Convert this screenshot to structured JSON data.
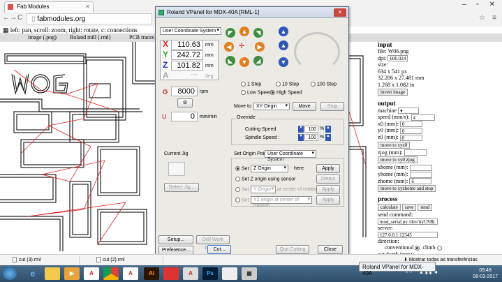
{
  "browser": {
    "tab_title": "Fab Modules",
    "url": "fabmodules.org",
    "nav_back": "←",
    "nav_forward": "→",
    "reload": "C",
    "window_controls": "– ▫ ✕",
    "star": "☆",
    "menu": "≡"
  },
  "fab": {
    "hint": "left: pan, scroll: zoom, right: rotate, c: connections",
    "fmt_image": "image (.png)",
    "fmt_machine": "Roland mill (.rml)",
    "fmt_process": "PCB traces (",
    "input": {
      "heading": "input",
      "file": "file: W06.png",
      "dpi_label": "dpi:",
      "dpi_value": "600.024",
      "size_label": "size:",
      "size_px": "634 x 541 px",
      "size_mm": "32.206 x 27.481 mm",
      "size_in": "1.268 x 1.082 in",
      "invert_button": "invert image"
    },
    "output": {
      "heading": "output",
      "machine_label": "machine",
      "speed_label": "speed (mm/s):",
      "speed_value": "4",
      "x0_label": "x0 (mm):",
      "x0_value": "0",
      "y0_label": "y0 (mm):",
      "y0_value": "0",
      "z0_label": "z0 (mm):",
      "z0_value": "0",
      "move_xyz0": "move to xyz0",
      "zjog_label": "zjog (mm):",
      "zjog_value": "",
      "move_xy0zjog": "move to xy0 zjog",
      "xhome_label": "xhome (mm):",
      "yhome_label": "yhome (mm):",
      "zhome_label": "zhome (mm):",
      "zhome_value": "6",
      "move_home": "move to xyzhome and stop"
    },
    "process": {
      "heading": "process",
      "calculate": "calculate",
      "save": "save",
      "send": "send",
      "send_command_label": "send command:",
      "send_command_value": "mod_serial.py /dev/ttyUSB(",
      "server_label": "server:",
      "server_value": "127.0.0.1:12345",
      "direction_label": "direction:",
      "conventional": "conventional",
      "climb": "climb",
      "cut_depth": "cut depth (mm):"
    }
  },
  "vpanel": {
    "title": "Roland VPanel for MDX-40A [RML-1]",
    "coord_system": "User Coordinate System",
    "x_label": "X",
    "x_value": "110.63",
    "y_label": "Y",
    "y_value": "242.72",
    "z_label": "Z",
    "z_value": "101.82",
    "a_label": "A",
    "a_value": "----",
    "unit_mm": "mm",
    "unit_deg": "deg",
    "spindle_value": "8000",
    "unit_rpm": "rpm",
    "feed_value": "0",
    "unit_mmmin": "mm/min",
    "step_1": "1 Step",
    "step_10": "10 Step",
    "step_100": "100 Step",
    "low_speed": "Low Speed",
    "high_speed": "High Speed",
    "move_to_label": "Move to",
    "move_to_select": "XY Origin",
    "move_button": "Move",
    "stop_button": "Stop",
    "override_label": "Override",
    "cutting_speed_label": "Cutting Speed",
    "cutting_speed_value": "100",
    "spindle_speed_label": "Spindle Speed :",
    "spindle_speed_value": "100",
    "percent": "%",
    "current_jig": "Current Jig",
    "detect_jig": "Detect Jig...",
    "set_origin_label": "Set Origin Point",
    "set_origin_select": "User Coordinate System",
    "set_label": "Set",
    "origin_select_1": "Z Origin",
    "here": "here",
    "apply": "Apply",
    "set_z_sensor": "Set Z origin using sensor",
    "detect": "Detect",
    "origin_select_3": "Y Origin",
    "at_center": "at center of rotation",
    "origin_select_4": "YZ origin at center of rotation",
    "setup": "Setup...",
    "drill_work": "Drill Work piece...",
    "preference": "Preference...",
    "cut": "Cut...",
    "quit_cutting": "Quit Cutting",
    "close": "Close"
  },
  "downloads": [
    {
      "name": "cut (3).rml"
    },
    {
      "name": "cut (2).rml"
    }
  ],
  "downloads_show_all": "Mostrar todas as transferências",
  "taskbar": {
    "popup": "Roland VPanel for MDX-40A",
    "lang": "PT",
    "time": "09:48",
    "date": "08-03-2017",
    "ai": "Ai",
    "ps": "Ps"
  }
}
